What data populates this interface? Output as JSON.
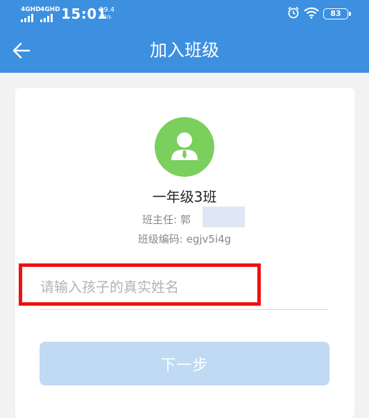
{
  "status_bar": {
    "signal1_label": "4GHD",
    "signal2_label": "4GHD",
    "time": "15:01",
    "speed_value": "29.4",
    "speed_unit": "KB/s",
    "battery": "83"
  },
  "header": {
    "title": "加入班级"
  },
  "class_info": {
    "name": "一年级3班",
    "teacher": "班主任: 郭",
    "code": "班级编码: egjv5i4g"
  },
  "form": {
    "name_placeholder": "请输入孩子的真实姓名",
    "name_value": "",
    "next_label": "下一步"
  },
  "colors": {
    "header_bg": "#3d8fe0",
    "avatar_bg": "#7bcf5c",
    "button_bg": "#bfdaf2",
    "highlight_border": "#ee1111"
  }
}
